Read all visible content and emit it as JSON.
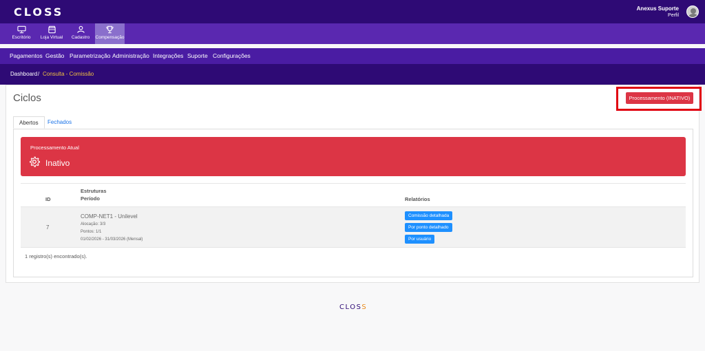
{
  "header": {
    "logo": "CLOSS",
    "user_name": "Anexus Suporte",
    "user_link": "Perfil"
  },
  "modules": [
    {
      "label": "Escritório",
      "icon": "monitor-icon"
    },
    {
      "label": "Loja Virtual",
      "icon": "store-icon"
    },
    {
      "label": "Cadastro",
      "icon": "user-icon"
    },
    {
      "label": "Compensação",
      "icon": "trophy-icon",
      "active": true
    }
  ],
  "nav": [
    "Pagamentos",
    "Gestão",
    "Parametrização",
    "Administração",
    "Integrações",
    "Suporte",
    "Configurações"
  ],
  "breadcrumb": {
    "home": "Dashboard",
    "separator": "/",
    "current": "Consulta - Comissão"
  },
  "page": {
    "title": "Ciclos",
    "process_button": "Processamento (INATIVO)"
  },
  "tabs": [
    "Abertos",
    "Fechados"
  ],
  "alert": {
    "label": "Processamento Atual",
    "status": "Inativo",
    "color": "#dc3545"
  },
  "table": {
    "col_id": "ID",
    "col_estruturas": "Estruturas",
    "col_periodo": "Período",
    "col_relatorios": "Relatórios",
    "rows": [
      {
        "id": "7",
        "structure": "COMP-NET1 - Unilevel",
        "alocacao": "Alocação: 3/3",
        "pontos": "Pontos: 1/1",
        "periodo": "01/02/2026 - 31/03/2026 (Mensal)",
        "buttons": [
          "Comissão detalhada",
          "Por ponto detalhado",
          "Por usuário"
        ]
      }
    ],
    "count_text": "1 registro(s) encontrado(s)."
  },
  "footer": {
    "logo_main": "CLOS",
    "logo_accent": "S"
  },
  "colors": {
    "topbar": "#2e0a75",
    "modbar": "#5a28b0",
    "nav": "#4a1ca3",
    "danger": "#dc3545",
    "primary": "#1e90ff"
  }
}
